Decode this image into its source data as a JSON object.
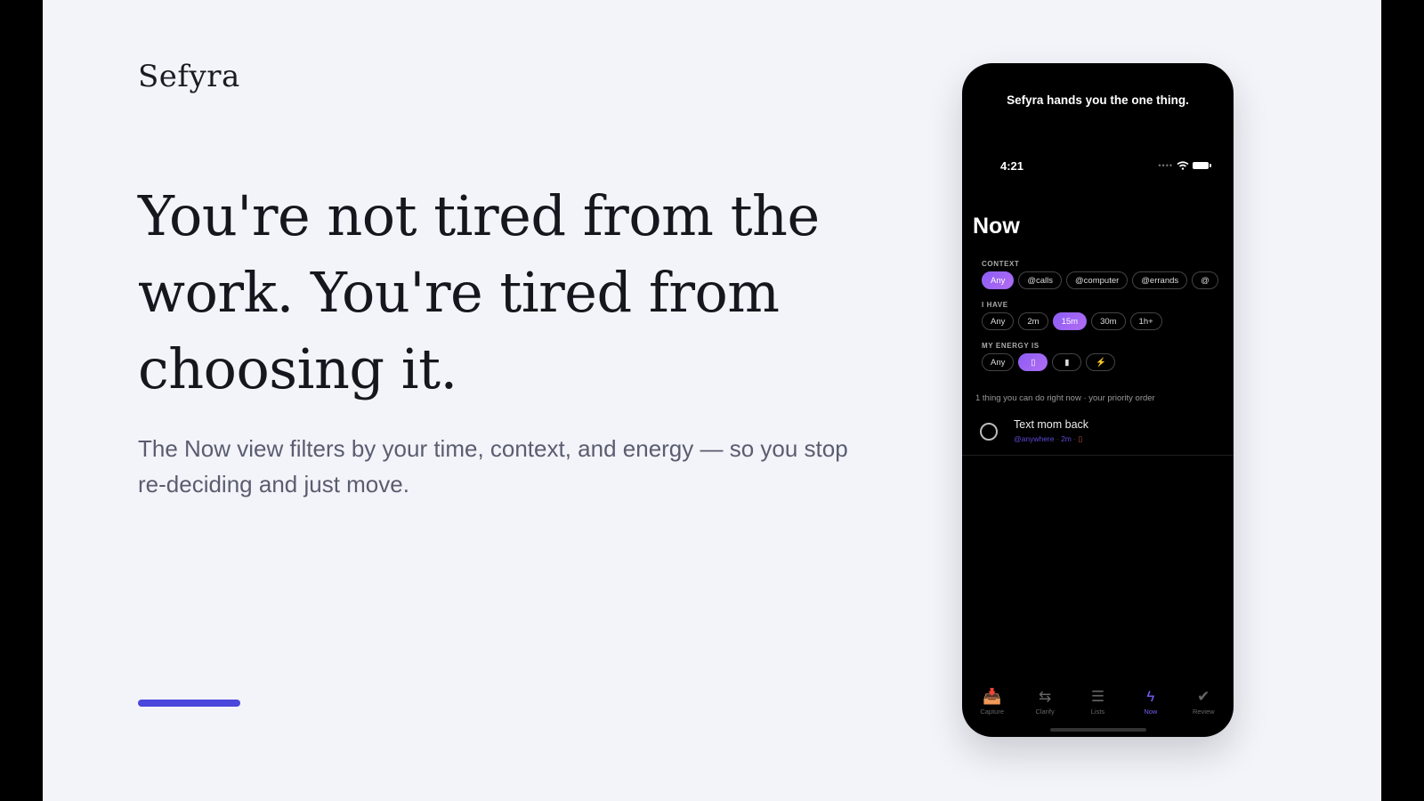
{
  "brand": "Sefyra",
  "headline": "You're not tired from the work. You're tired from choosing it.",
  "subhead": "The Now view filters by your time, context, and energy — so you stop re-deciding and just move.",
  "accent_color": "#4b46dc",
  "phone": {
    "caption": "Sefyra hands you the one thing.",
    "status_time": "4:21",
    "screen_title": "Now",
    "context": {
      "label": "CONTEXT",
      "chips": [
        {
          "label": "Any",
          "active": true
        },
        {
          "label": "@calls",
          "active": false
        },
        {
          "label": "@computer",
          "active": false
        },
        {
          "label": "@errands",
          "active": false
        },
        {
          "label": "@",
          "active": false
        }
      ]
    },
    "time": {
      "label": "I HAVE",
      "chips": [
        {
          "label": "Any",
          "active": false
        },
        {
          "label": "2m",
          "active": false
        },
        {
          "label": "15m",
          "active": true
        },
        {
          "label": "30m",
          "active": false
        },
        {
          "label": "1h+",
          "active": false
        }
      ]
    },
    "energy": {
      "label": "MY ENERGY IS",
      "chips": [
        {
          "label": "Any",
          "active": false
        },
        {
          "icon": "low-battery-icon",
          "glyph": "▯",
          "active": true
        },
        {
          "icon": "full-battery-icon",
          "glyph": "▮",
          "active": false
        },
        {
          "icon": "lightning-icon",
          "glyph": "⚡",
          "active": false
        }
      ]
    },
    "hint": "1 thing you can do right now · your priority order",
    "task": {
      "title": "Text mom back",
      "context": "@anywhere",
      "sep": "·",
      "duration": "2m",
      "energy_icon": "low-battery-icon",
      "energy_glyph": "▯"
    },
    "tabs": [
      {
        "label": "Capture",
        "icon": "inbox-icon",
        "glyph": "📥",
        "active": false
      },
      {
        "label": "Clarify",
        "icon": "arrows-icon",
        "glyph": "⇆",
        "active": false
      },
      {
        "label": "Lists",
        "icon": "list-icon",
        "glyph": "☰",
        "active": false
      },
      {
        "label": "Now",
        "icon": "lightning-icon",
        "glyph": "ϟ",
        "active": true
      },
      {
        "label": "Review",
        "icon": "check-circle-icon",
        "glyph": "✔",
        "active": false
      }
    ]
  }
}
